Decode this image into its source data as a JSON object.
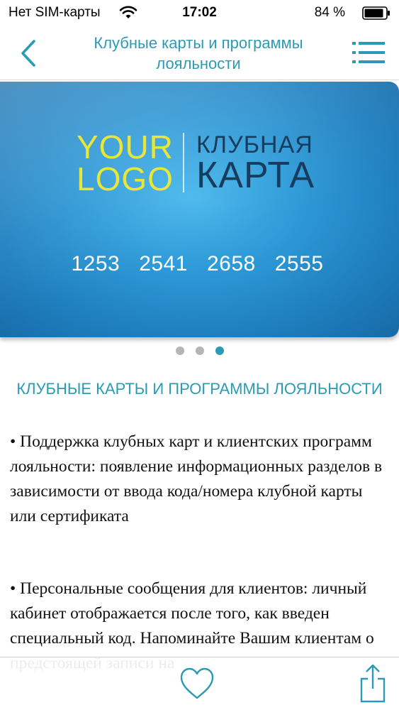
{
  "status_bar": {
    "carrier": "Нет SIM-карты",
    "time": "17:02",
    "battery": "84 %",
    "wifi_icon": "wifi-icon",
    "battery_icon": "battery-icon"
  },
  "nav": {
    "title": "Клубные карты и программы лояльности",
    "back_icon": "chevron-left-icon",
    "menu_icon": "menu-icon",
    "accent_color": "#2b9bb4"
  },
  "card": {
    "logo_line1": "YOUR",
    "logo_line2": "LOGO",
    "label_line1": "КЛУБНАЯ",
    "label_line2": "КАРТА",
    "number_groups": [
      "1253",
      "2541",
      "2658",
      "2555"
    ],
    "logo_color": "#e9e63a",
    "label_color": "#173d5e",
    "background_color": "#2f9bd8"
  },
  "pager": {
    "count": 3,
    "active_index": 2
  },
  "content": {
    "heading": "КЛУБНЫЕ КАРТЫ И ПРОГРАММЫ ЛОЯЛЬНОСТИ",
    "paragraph1": "• Поддержка клубных карт и клиентских программ лояльности: появление информационных разделов в зависимости от ввода кода/номера клубной карты или сертификата",
    "paragraph2": "• Персональные сообщения для клиентов: личный кабинет отображается после того, как введен специальный код. Напоминайте Вашим клиентам о предстоящей записи на"
  },
  "bottom_bar": {
    "favorite_icon": "heart-icon",
    "share_icon": "share-icon"
  }
}
